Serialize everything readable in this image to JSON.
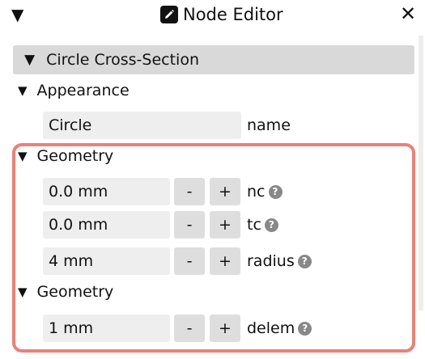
{
  "window": {
    "title": "Node Editor",
    "collapse_glyph": "▼",
    "close_glyph": "✕",
    "title_icon": "pencil-icon"
  },
  "panel": {
    "title": "Circle Cross-Section",
    "tri": "▼"
  },
  "appearance": {
    "label": "Appearance",
    "tri": "▼",
    "name_value": "Circle",
    "name_label": "name"
  },
  "geometry1": {
    "label": "Geometry",
    "tri": "▼",
    "rows": [
      {
        "value": "0.0 mm",
        "minus": "-",
        "plus": "+",
        "label": "nc",
        "help": "?"
      },
      {
        "value": "0.0 mm",
        "minus": "-",
        "plus": "+",
        "label": "tc",
        "help": "?"
      },
      {
        "value": "4 mm",
        "minus": "-",
        "plus": "+",
        "label": "radius",
        "help": "?"
      }
    ]
  },
  "geometry2": {
    "label": "Geometry",
    "tri": "▼",
    "rows": [
      {
        "value": "1 mm",
        "minus": "-",
        "plus": "+",
        "label": "delem",
        "help": "?"
      }
    ]
  },
  "colors": {
    "highlight": "#e8827a",
    "field_bg": "#eeeeee",
    "button_bg": "#dedede",
    "header_bg": "#d9d9d9"
  }
}
